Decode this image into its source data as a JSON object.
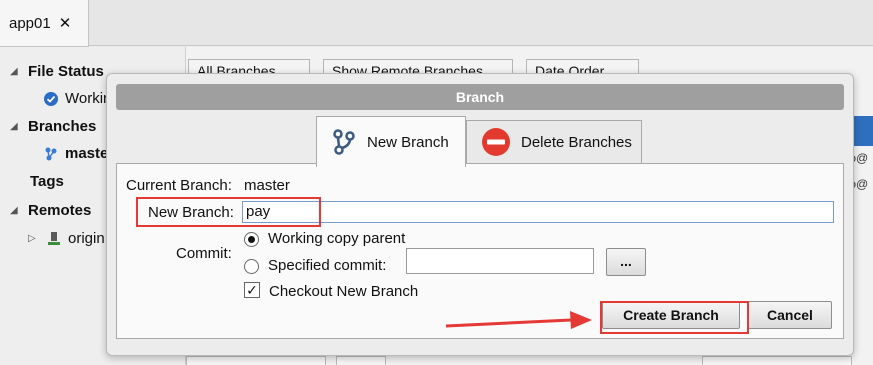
{
  "app": {
    "tab_label": "app01",
    "tab_close": "✕"
  },
  "sidebar": {
    "file_status": "File Status",
    "working_copy": "Working Copy",
    "branches": "Branches",
    "master": "master",
    "tags": "Tags",
    "remotes": "Remotes",
    "origin": "origin"
  },
  "toolbar": {
    "branches_filter": "All Branches",
    "show_remote": "Show Remote Branches",
    "order": "Date Order"
  },
  "dialog": {
    "title": "Branch",
    "tabs": [
      {
        "label": "New Branch",
        "icon": "branch-icon",
        "active": true
      },
      {
        "label": "Delete Branches",
        "icon": "delete-icon",
        "active": false
      }
    ],
    "current_branch_label": "Current Branch:",
    "current_branch_value": "master",
    "new_branch_label": "New Branch:",
    "new_branch_value": "pay",
    "commit_label": "Commit:",
    "working_copy_parent": "Working copy parent",
    "specified_commit": "Specified commit:",
    "specified_commit_value": "",
    "browse_label": "...",
    "checkout_label": "Checkout New Branch",
    "checkout_checked": true,
    "create_button": "Create Branch",
    "cancel_button": "Cancel"
  },
  "annotation_color": "#e53935"
}
